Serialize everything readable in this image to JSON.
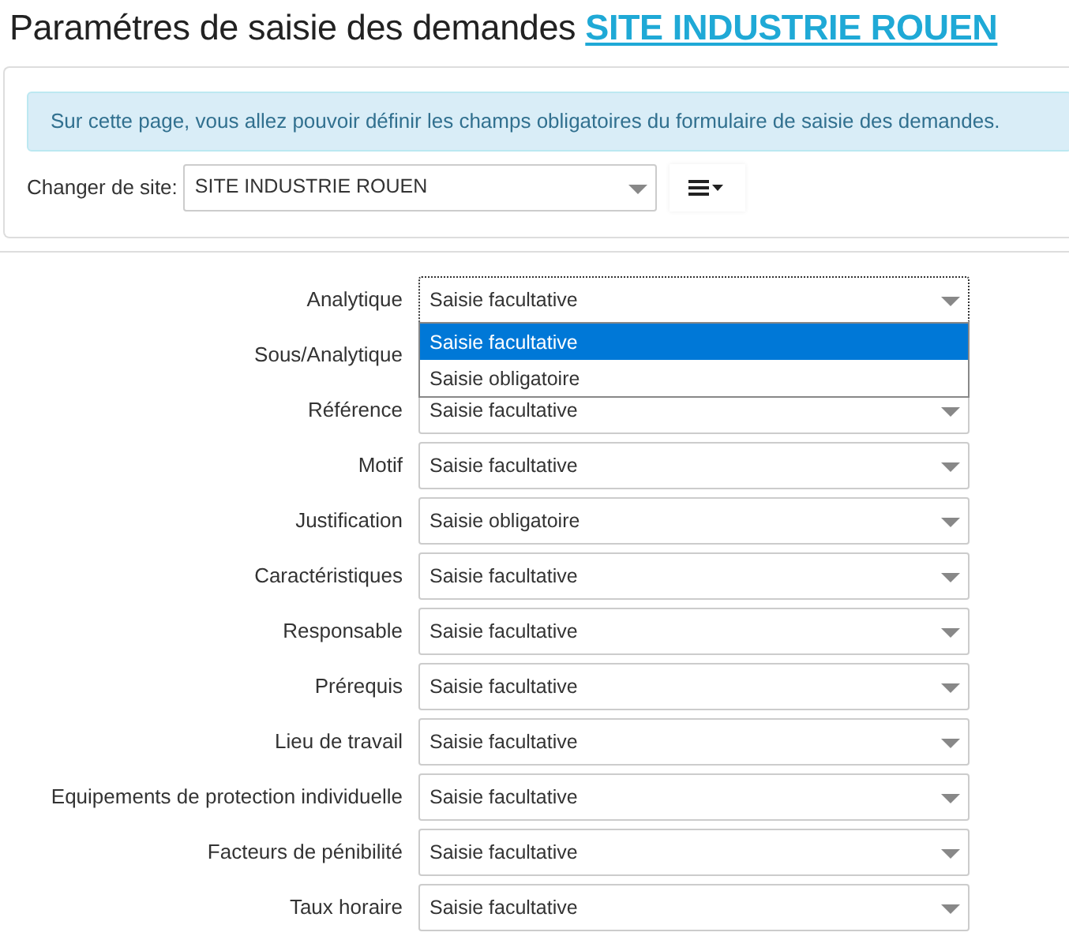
{
  "heading": {
    "title": "Paramétres de saisie des demandes",
    "site_link": "SITE INDUSTRIE ROUEN"
  },
  "alert": "Sur cette page, vous allez pouvoir définir les champs obligatoires du formulaire de saisie des demandes.",
  "site_picker": {
    "label": "Changer de site:",
    "value": "SITE INDUSTRIE ROUEN"
  },
  "fields": [
    {
      "label": "Analytique",
      "value": "Saisie facultative",
      "open": true,
      "options": [
        {
          "label": "Saisie facultative",
          "selected": true
        },
        {
          "label": "Saisie obligatoire",
          "selected": false
        }
      ]
    },
    {
      "label": "Sous/Analytique"
    },
    {
      "label": "Référence",
      "value": "Saisie facultative",
      "open": false
    },
    {
      "label": "Motif",
      "value": "Saisie facultative",
      "open": false
    },
    {
      "label": "Justification",
      "value": "Saisie obligatoire",
      "open": false
    },
    {
      "label": "Caractéristiques",
      "value": "Saisie facultative",
      "open": false
    },
    {
      "label": "Responsable",
      "value": "Saisie facultative",
      "open": false
    },
    {
      "label": "Prérequis",
      "value": "Saisie facultative",
      "open": false
    },
    {
      "label": "Lieu de travail",
      "value": "Saisie facultative",
      "open": false
    },
    {
      "label": "Equipements de protection individuelle",
      "value": "Saisie facultative",
      "open": false
    },
    {
      "label": "Facteurs de pénibilité",
      "value": "Saisie facultative",
      "open": false
    },
    {
      "label": "Taux horaire",
      "value": "Saisie facultative",
      "open": false
    }
  ]
}
